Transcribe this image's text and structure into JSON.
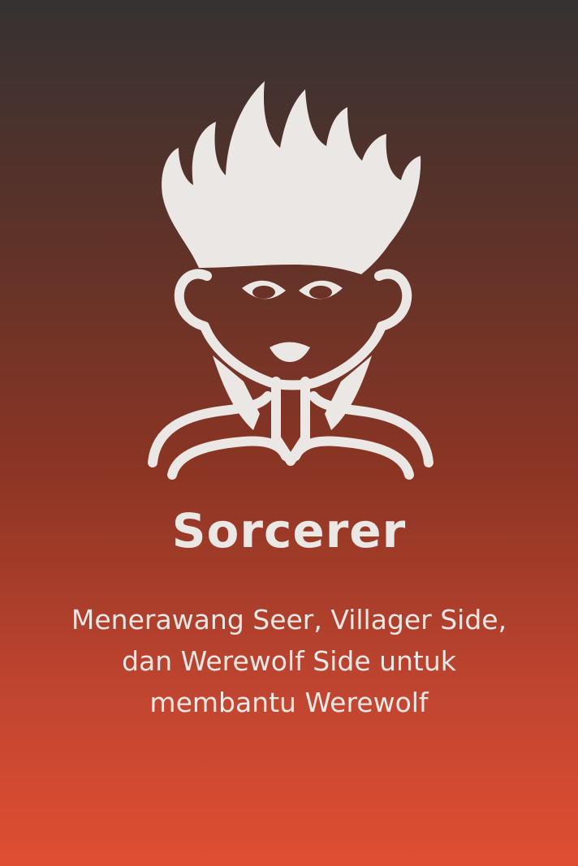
{
  "card": {
    "role_name": "Sorcerer",
    "description": "Menerawang Seer, Villager Side, dan Werewolf Side untuk membantu Werewolf",
    "icon": "sorcerer-character-icon",
    "colors": {
      "gradient_top": "#353232",
      "gradient_bottom": "#e04e32",
      "foreground": "#ebe7e5"
    }
  }
}
